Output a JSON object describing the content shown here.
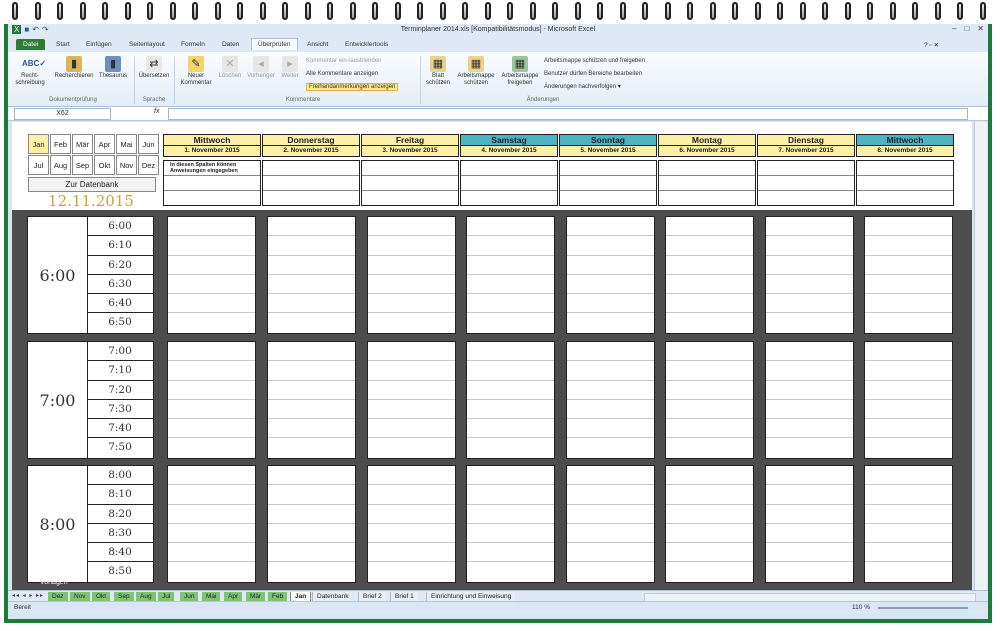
{
  "window": {
    "title": "Terminplaner 2014.xls [Kompatibilitätsmodus] - Microsoft Excel",
    "controls": [
      "–",
      "□",
      "✕"
    ]
  },
  "ribbon_tabs": [
    "Datei",
    "Start",
    "Einfügen",
    "Seitenlayout",
    "Formeln",
    "Daten",
    "Überprüfen",
    "Ansicht",
    "Entwicklertools"
  ],
  "ribbon": {
    "dokumentpruefung": {
      "label": "Dokumentprüfung",
      "rechtschreibung": "Recht-\nschreibung",
      "recherchieren": "Recherchieren",
      "thesaurus": "Thesaurus"
    },
    "sprache": {
      "label": "Sprache",
      "uebersetzen": "Übersetzen"
    },
    "kommentare": {
      "label": "Kommentare",
      "neuer_kommentar": "Neuer\nKommentar",
      "loeschen": "Löschen",
      "vorheriger": "Vorheriger",
      "weiter": "Weiter",
      "ein_ausblenden": "Kommentar ein-/ausblenden",
      "alle_anzeigen": "Alle Kommentare anzeigen",
      "freihand": "Freihandanmerkungen anzeigen"
    },
    "aenderungen": {
      "label": "Änderungen",
      "blatt_schuetzen": "Blatt\nschützen",
      "arbeitsmappe_schuetzen": "Arbeitsmappe\nschützen",
      "arbeitsmappe_freigeben": "Arbeitsmappe\nfreigeben",
      "schuetzen_freigeben": "Arbeitsmappe schützen und freigeben",
      "benutzer_bereiche": "Benutzer dürfen Bereiche bearbeiten",
      "nachverfolgen": "Änderungen nachverfolgen ▾"
    }
  },
  "formula_bar": {
    "name_box": "X62",
    "fx": "fx",
    "value": ""
  },
  "months": [
    "Jan",
    "Feb",
    "Mär",
    "Apr",
    "Mai",
    "Jun",
    "Jul",
    "Aug",
    "Sep",
    "Okt",
    "Nov",
    "Dez"
  ],
  "datenbank_button": "Zur Datenbank",
  "current_date": "12.11.2015",
  "days": [
    {
      "name": "Mittwoch",
      "date": "1. November 2015",
      "weekend": false
    },
    {
      "name": "Donnerstag",
      "date": "2. November 2015",
      "weekend": false
    },
    {
      "name": "Freitag",
      "date": "3. November 2015",
      "weekend": false
    },
    {
      "name": "Samstag",
      "date": "4. November 2015",
      "weekend": true
    },
    {
      "name": "Sonntag",
      "date": "5. November 2015",
      "weekend": true
    },
    {
      "name": "Montag",
      "date": "6. November 2015",
      "weekend": false
    },
    {
      "name": "Dienstag",
      "date": "7. November 2015",
      "weekend": false
    },
    {
      "name": "Mittwoch",
      "date": "8. November 2015",
      "weekend": true
    }
  ],
  "notes_hint": "In diesen Spalten können Anweisungen eingegeben",
  "hours": [
    {
      "label": "6:00",
      "slots": [
        "6:00",
        "6:10",
        "6:20",
        "6:30",
        "6:40",
        "6:50"
      ]
    },
    {
      "label": "7:00",
      "slots": [
        "7:00",
        "7:10",
        "7:20",
        "7:30",
        "7:40",
        "7:50"
      ]
    },
    {
      "label": "8:00",
      "slots": [
        "8:00",
        "8:10",
        "8:20",
        "8:30",
        "8:40",
        "8:50"
      ]
    }
  ],
  "sheet_tabs": {
    "green": [
      "Dez",
      "Nov",
      "Okt",
      "Sep",
      "Aug",
      "Jul",
      "Jun",
      "Mai",
      "Apr",
      "Mär",
      "Feb"
    ],
    "active": "Jan",
    "plain": [
      "Datenbank",
      "Brief 2",
      "Brief 1",
      "Einrichtung und Einweisung"
    ]
  },
  "status": {
    "ready": "Bereit",
    "zoom": "110 %"
  },
  "watermark": "Vorlagen"
}
